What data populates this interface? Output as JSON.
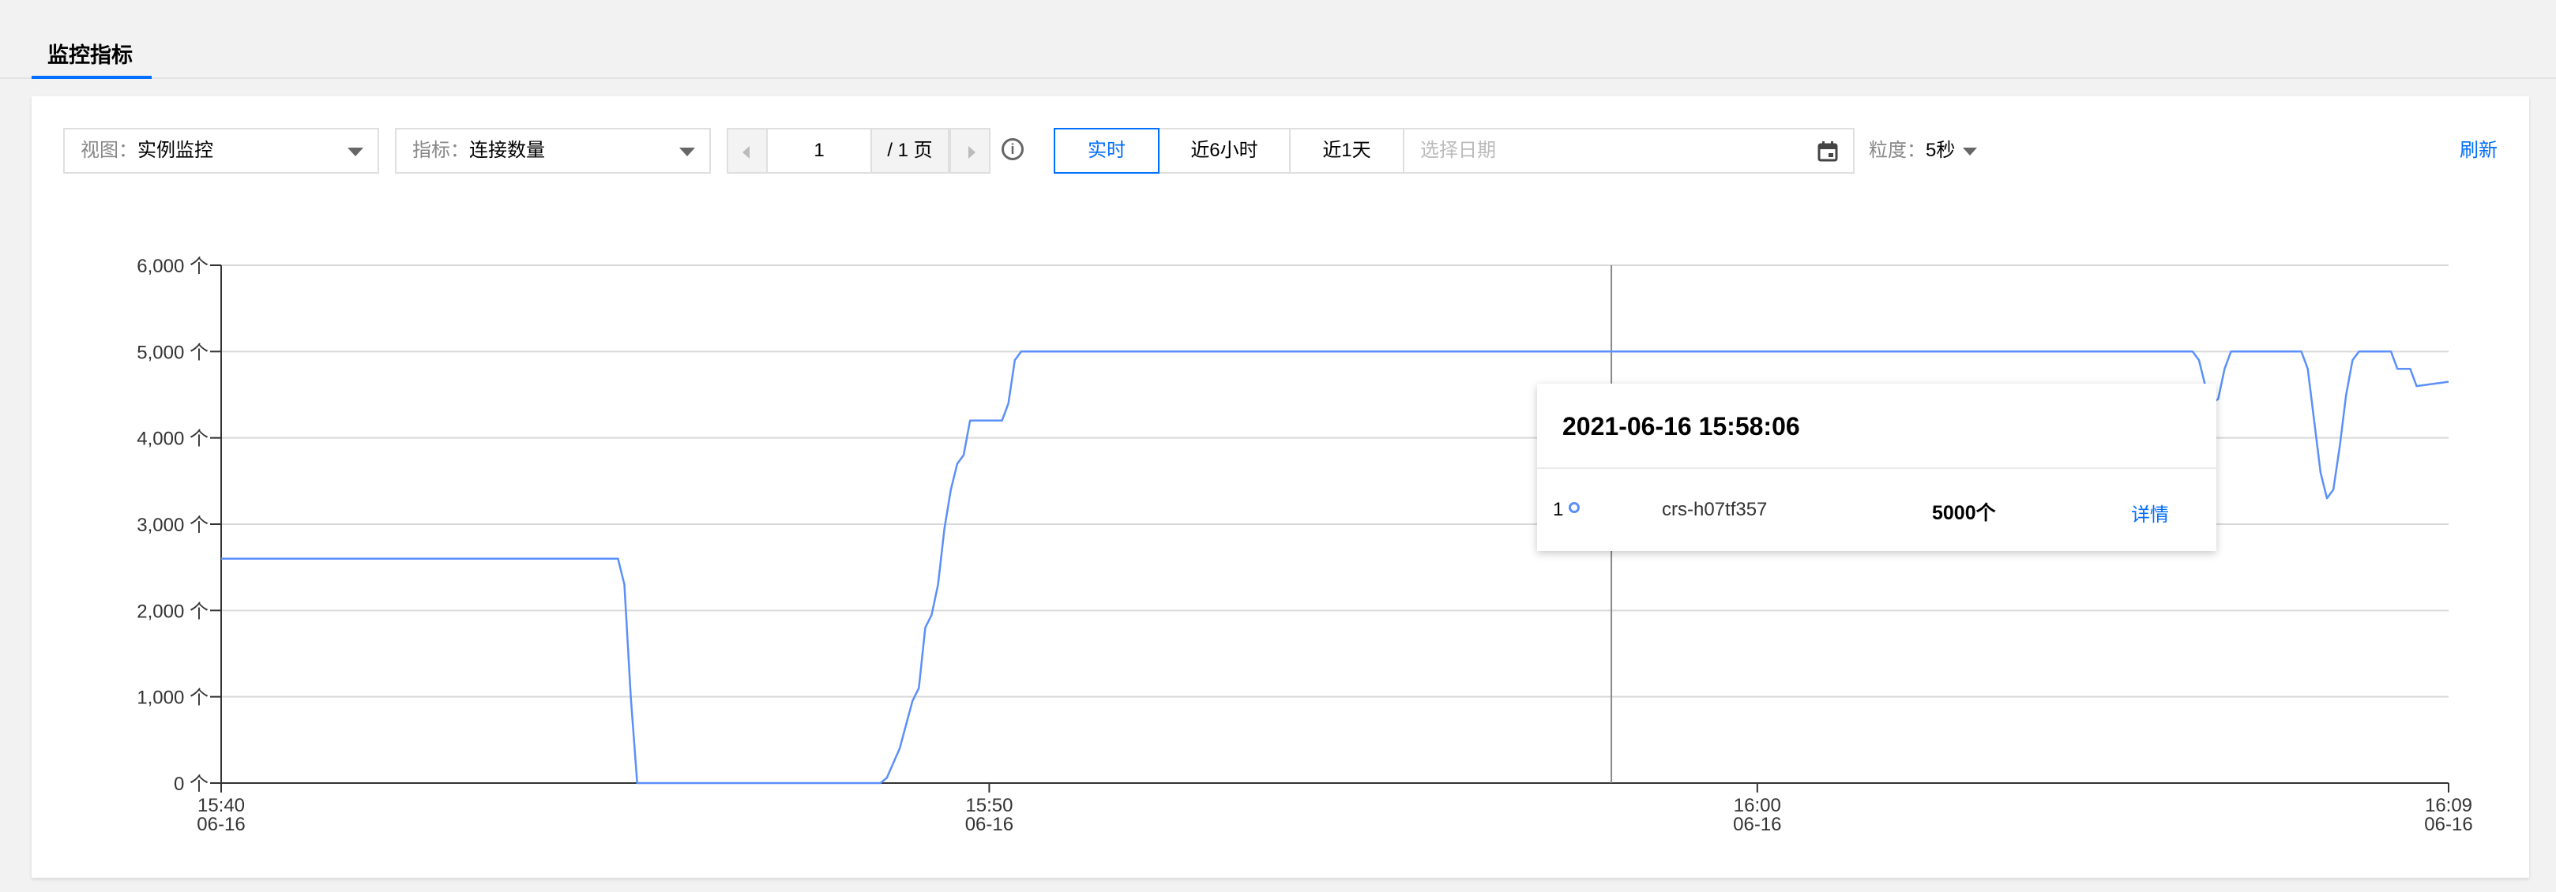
{
  "tabs": {
    "active_label": "监控指标"
  },
  "toolbar": {
    "view": {
      "label": "视图：",
      "value": "实例监控"
    },
    "metric": {
      "label": "指标：",
      "value": "连接数量"
    },
    "pager": {
      "current": "1",
      "total": "/ 1 页"
    },
    "ranges": [
      "实时",
      "近6小时",
      "近1天"
    ],
    "active_range": "实时",
    "date_placeholder": "选择日期",
    "granularity": {
      "label": "粒度：",
      "value": "5秒"
    },
    "refresh_label": "刷新"
  },
  "tooltip": {
    "time": "2021-06-16 15:58:06",
    "index": "1",
    "instance": "crs-h07tf357",
    "value": "5000个",
    "detail_label": "详情"
  },
  "colors": {
    "accent": "#006eff",
    "series": "#5b8ff9"
  },
  "icons": [
    "info-icon",
    "calendar-icon",
    "chevron-down-icon",
    "chevron-left-icon",
    "chevron-right-icon"
  ],
  "chart_data": {
    "type": "line",
    "ylim": [
      0,
      6000
    ],
    "y_ticks": [
      "0 个",
      "1,000 个",
      "2,000 个",
      "3,000 个",
      "4,000 个",
      "5,000 个",
      "6,000 个"
    ],
    "x_ticks": [
      {
        "time": "15:40",
        "date": "06-16"
      },
      {
        "time": "15:50",
        "date": "06-16"
      },
      {
        "time": "16:00",
        "date": "06-16"
      },
      {
        "time": "16:09",
        "date": "06-16"
      }
    ],
    "x_range": [
      "15:40:00",
      "16:09:00"
    ],
    "hover_time": "15:58:06",
    "series": [
      {
        "points": [
          [
            "15:40:00",
            2600
          ],
          [
            "15:45:10",
            2600
          ],
          [
            "15:45:15",
            2300
          ],
          [
            "15:45:20",
            1000
          ],
          [
            "15:45:25",
            0
          ],
          [
            "15:48:35",
            0
          ],
          [
            "15:48:40",
            60
          ],
          [
            "15:48:50",
            400
          ],
          [
            "15:49:00",
            950
          ],
          [
            "15:49:05",
            1100
          ],
          [
            "15:49:10",
            1800
          ],
          [
            "15:49:15",
            1950
          ],
          [
            "15:49:20",
            2300
          ],
          [
            "15:49:25",
            2950
          ],
          [
            "15:49:30",
            3400
          ],
          [
            "15:49:35",
            3700
          ],
          [
            "15:49:40",
            3800
          ],
          [
            "15:49:45",
            4200
          ],
          [
            "15:50:10",
            4200
          ],
          [
            "15:50:15",
            4400
          ],
          [
            "15:50:20",
            4900
          ],
          [
            "15:50:25",
            5000
          ],
          [
            "16:05:40",
            5000
          ],
          [
            "16:05:45",
            4900
          ],
          [
            "16:05:50",
            4600
          ],
          [
            "16:05:55",
            4400
          ],
          [
            "16:06:00",
            4450
          ],
          [
            "16:06:05",
            4800
          ],
          [
            "16:06:10",
            5000
          ],
          [
            "16:07:05",
            5000
          ],
          [
            "16:07:10",
            4800
          ],
          [
            "16:07:15",
            4200
          ],
          [
            "16:07:20",
            3600
          ],
          [
            "16:07:25",
            3300
          ],
          [
            "16:07:30",
            3400
          ],
          [
            "16:07:35",
            3900
          ],
          [
            "16:07:40",
            4500
          ],
          [
            "16:07:45",
            4900
          ],
          [
            "16:07:50",
            5000
          ],
          [
            "16:08:15",
            5000
          ],
          [
            "16:08:20",
            4800
          ],
          [
            "16:08:30",
            4800
          ],
          [
            "16:08:35",
            4600
          ],
          [
            "16:09:00",
            4650
          ]
        ]
      }
    ]
  }
}
